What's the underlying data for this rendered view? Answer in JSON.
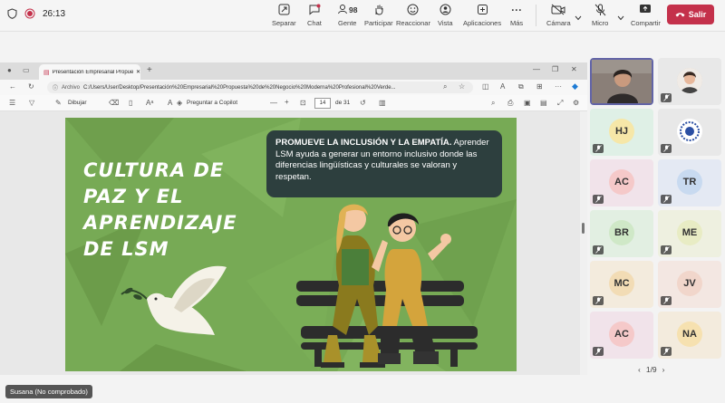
{
  "meeting": {
    "timer": "26:13",
    "participants_count": "98",
    "toolbar": [
      {
        "name": "share",
        "label": "Separar"
      },
      {
        "name": "chat",
        "label": "Chat"
      },
      {
        "name": "people",
        "label": "Gente"
      },
      {
        "name": "raise-hand",
        "label": "Participar"
      },
      {
        "name": "react",
        "label": "Reaccionar"
      },
      {
        "name": "view",
        "label": "Vista"
      },
      {
        "name": "apps",
        "label": "Aplicaciones"
      },
      {
        "name": "more",
        "label": "Más"
      },
      {
        "name": "camera",
        "label": "Cámara"
      },
      {
        "name": "mic",
        "label": "Micro"
      },
      {
        "name": "share-content",
        "label": "Compartir"
      }
    ],
    "leave_label": "Salir",
    "leave_color": "#c4314b"
  },
  "browser": {
    "tab_title": "Presentación Empresarial Propues",
    "url_tag": "Archivo",
    "url": "C:/Users/User/Desktop/Presentación%20Empresarial%20Propuesta%20de%20Negocio%20Moderna%20Profesional%20Verde...",
    "pdf_toolbar": {
      "draw": "Dibujar",
      "copilot": "Preguntar a Copilot",
      "page": "14",
      "of": "de 31"
    }
  },
  "slide": {
    "title": "CULTURA DE PAZ Y EL APRENDIZAJE DE LSM",
    "info_bold": "PROMUEVE LA INCLUSIÓN Y LA EMPATÍA.",
    "info_text": " Aprender LSM ayuda a generar un entorno inclusivo donde las diferencias lingüísticas y culturales se valoran y respetan.",
    "bg_color": "#77aa55"
  },
  "participants": {
    "initials": [
      "HJ",
      "AC",
      "TR",
      "BR",
      "ME",
      "MC",
      "JV",
      "AC",
      "NA"
    ],
    "pager": "1/9"
  },
  "shared_by": "Susana (No comprobado)"
}
